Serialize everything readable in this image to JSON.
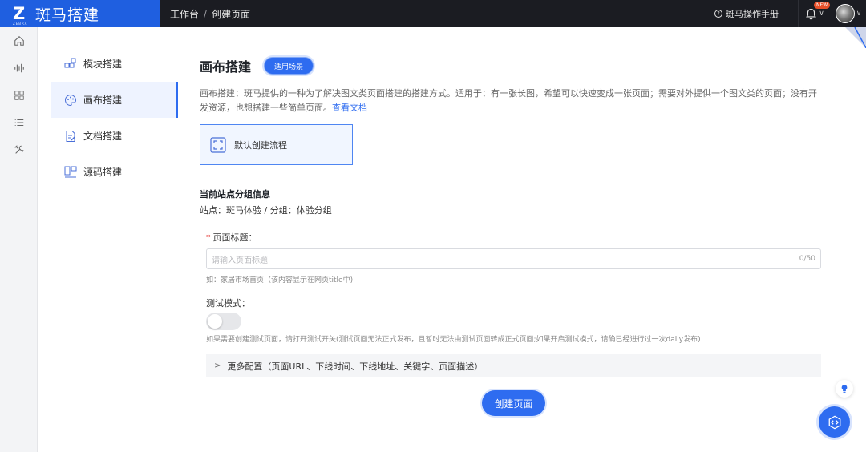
{
  "app": {
    "logo_mark": "Z",
    "logo_small": "ZEBRA",
    "name": "斑马搭建"
  },
  "breadcrumb": [
    "工作台",
    "创建页面"
  ],
  "breadcrumb_sep": "/",
  "header": {
    "manual_label": "斑马操作手册",
    "new_badge": "NEW"
  },
  "rail": {
    "icons": [
      "home-icon",
      "waveform-icon",
      "grid-icon",
      "list-icon",
      "tools-icon"
    ]
  },
  "subnav": {
    "items": [
      {
        "label": "模块搭建",
        "icon": "blocks-icon",
        "active": false
      },
      {
        "label": "画布搭建",
        "icon": "palette-icon",
        "active": true
      },
      {
        "label": "文档搭建",
        "icon": "document-edit-icon",
        "active": false
      },
      {
        "label": "源码搭建",
        "icon": "code-layout-icon",
        "active": false
      }
    ]
  },
  "main": {
    "title": "画布搭建",
    "scene_button": "适用场景",
    "description": "画布搭建：斑马提供的一种为了解决图文类页面搭建的搭建方式。适用于：有一张长图，希望可以快速变成一张页面；需要对外提供一个图文类的页面；没有开发资源，也想搭建一些简单页面。",
    "doc_link": "查看文档",
    "flow_card": "默认创建流程",
    "group_title": "当前站点分组信息",
    "group_info": "站点：斑马体验 / 分组：体验分组"
  },
  "form": {
    "title_label": "页面标题：",
    "required_mark": "*",
    "title_placeholder": "请输入页面标题",
    "title_count": "0/50",
    "title_hint": "如：家居市场首页（该内容显示在网页title中)",
    "test_label": "测试模式：",
    "test_enabled": false,
    "test_hint": "如果需要创建测试页面，请打开测试开关(测试页面无法正式发布，且暂时无法由测试页面转成正式页面;如果开启测试模式，请确已经进行过一次daily发布)",
    "more_config": "更多配置（页面URL、下线时间、下线地址、关键字、页面描述）"
  },
  "actions": {
    "create_button": "创建页面"
  },
  "colors": {
    "primary": "#2e6cf0",
    "topbar": "#1b1c22",
    "logo_bg": "#1f5fe0"
  }
}
